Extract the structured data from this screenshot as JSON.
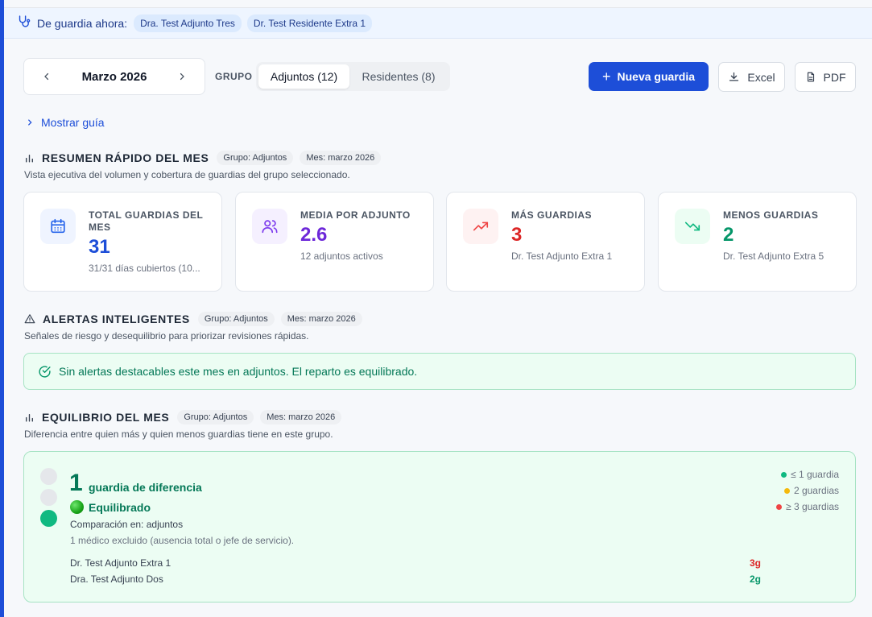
{
  "oncall": {
    "label": "De guardia ahora:",
    "doctors": [
      "Dra. Test Adjunto Tres",
      "Dr. Test Residente Extra 1"
    ]
  },
  "toolbar": {
    "month": "Marzo 2026",
    "group_label": "GRUPO",
    "group_options": [
      "Adjuntos (12)",
      "Residentes (8)"
    ],
    "selected_group": "Adjuntos (12)",
    "new_button": "Nueva guardia",
    "excel_button": "Excel",
    "pdf_button": "PDF"
  },
  "guide": {
    "label": "Mostrar guía"
  },
  "summary": {
    "title": "RESUMEN RÁPIDO DEL MES",
    "chips": [
      "Grupo: Adjuntos",
      "Mes: marzo 2026"
    ],
    "subtitle": "Vista ejecutiva del volumen y cobertura de guardias del grupo seleccionado.",
    "cards": [
      {
        "title": "TOTAL GUARDIAS DEL MES",
        "value": "31",
        "sub": "31/31 días cubiertos (10...",
        "color": "#1d4ed8",
        "icon": "calendar-icon"
      },
      {
        "title": "MEDIA POR ADJUNTO",
        "value": "2.6",
        "sub": "12 adjuntos activos",
        "color": "#6d28d9",
        "icon": "users-icon"
      },
      {
        "title": "MÁS GUARDIAS",
        "value": "3",
        "sub": "Dr. Test Adjunto Extra 1",
        "color": "#dc2626",
        "icon": "trending-up-icon"
      },
      {
        "title": "MENOS GUARDIAS",
        "value": "2",
        "sub": "Dr. Test Adjunto Extra 5",
        "color": "#059669",
        "icon": "trending-down-icon"
      }
    ]
  },
  "alerts": {
    "title": "ALERTAS INTELIGENTES",
    "chips": [
      "Grupo: Adjuntos",
      "Mes: marzo 2026"
    ],
    "subtitle": "Señales de riesgo y desequilibrio para priorizar revisiones rápidas.",
    "message": "Sin alertas destacables este mes en adjuntos. El reparto es equilibrado."
  },
  "balance": {
    "title": "EQUILIBRIO DEL MES",
    "chips": [
      "Grupo: Adjuntos",
      "Mes: marzo 2026"
    ],
    "subtitle": "Diferencia entre quien más y quien menos guardias tiene en este grupo.",
    "difference": "1",
    "difference_label": "guardia de diferencia",
    "status": "Equilibrado",
    "comparison": "Comparación en: adjuntos",
    "excluded": "1 médico excluido (ausencia total o jefe de servicio).",
    "rows": [
      {
        "name": "Dr. Test Adjunto Extra 1",
        "count": "3g",
        "color": "#dc2626"
      },
      {
        "name": "Dra. Test Adjunto Dos",
        "count": "2g",
        "color": "#059669"
      }
    ],
    "legend": [
      {
        "label": "≤ 1 guardia",
        "color": "#10b981"
      },
      {
        "label": "2 guardias",
        "color": "#f5b90b"
      },
      {
        "label": "≥ 3 guardias",
        "color": "#ef4444"
      }
    ]
  }
}
